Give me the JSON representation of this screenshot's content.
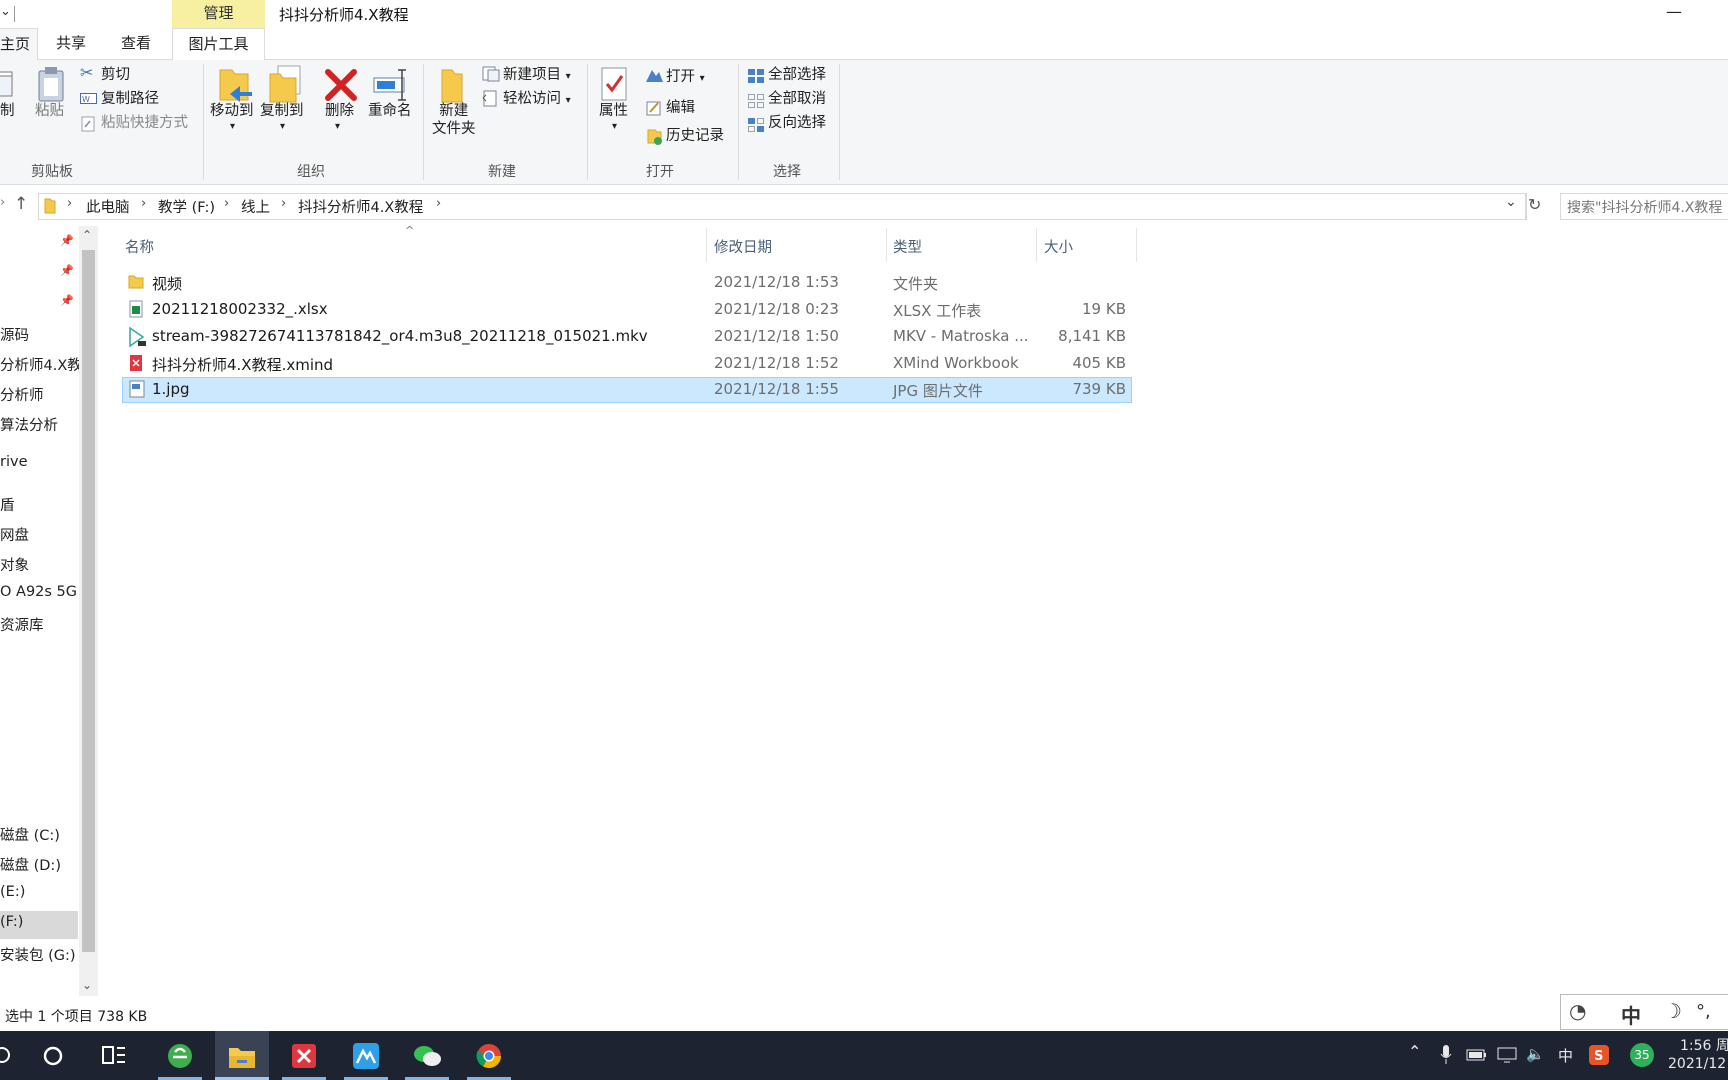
{
  "window": {
    "title": "抖抖分析师4.X教程",
    "context_tab": "管理",
    "minimize": "—"
  },
  "tabs": {
    "home": "主页",
    "share": "共享",
    "view": "查看",
    "picture_tools": "图片工具"
  },
  "ribbon": {
    "clipboard": {
      "label": "剪贴板",
      "copy": "制",
      "paste": "粘贴",
      "cut": "剪切",
      "copy_path": "复制路径",
      "paste_shortcut": "粘贴快捷方式"
    },
    "organize": {
      "label": "组织",
      "move_to": "移动到",
      "copy_to": "复制到",
      "delete": "删除",
      "rename": "重命名"
    },
    "new": {
      "label": "新建",
      "new_folder_line1": "新建",
      "new_folder_line2": "文件夹",
      "new_item": "新建项目",
      "easy_access": "轻松访问"
    },
    "open": {
      "label": "打开",
      "properties": "属性",
      "open": "打开",
      "edit": "编辑",
      "history": "历史记录"
    },
    "select": {
      "label": "选择",
      "select_all": "全部选择",
      "select_none": "全部取消",
      "invert": "反向选择"
    }
  },
  "address": {
    "crumbs": [
      "此电脑",
      "教学 (F:)",
      "线上",
      "抖抖分析师4.X教程"
    ],
    "search_placeholder": "搜索\"抖抖分析师4.X教程"
  },
  "nav": {
    "items": [
      "源码",
      "分析师4.X教",
      "分析师",
      "算法分析",
      "rive",
      "盾",
      "网盘",
      "对象",
      "O A92s 5G",
      "资源库",
      "磁盘 (C:)",
      "磁盘 (D:)",
      "(E:)",
      "(F:)",
      "安装包 (G:)"
    ]
  },
  "columns": {
    "name": "名称",
    "modified": "修改日期",
    "type": "类型",
    "size": "大小"
  },
  "files": [
    {
      "name": "视频",
      "modified": "2021/12/18 1:53",
      "type": "文件夹",
      "size": "",
      "icon": "folder-icon"
    },
    {
      "name": "20211218002332_.xlsx",
      "modified": "2021/12/18 0:23",
      "type": "XLSX 工作表",
      "size": "19 KB",
      "icon": "excel-file-icon"
    },
    {
      "name": "stream-398272674113781842_or4.m3u8_20211218_015021.mkv",
      "modified": "2021/12/18 1:50",
      "type": "MKV - Matroska ...",
      "size": "8,141 KB",
      "icon": "video-file-icon"
    },
    {
      "name": "抖抖分析师4.X教程.xmind",
      "modified": "2021/12/18 1:52",
      "type": "XMind Workbook",
      "size": "405 KB",
      "icon": "xmind-file-icon"
    },
    {
      "name": "1.jpg",
      "modified": "2021/12/18 1:55",
      "type": "JPG 图片文件",
      "size": "739 KB",
      "icon": "image-file-icon"
    }
  ],
  "status": {
    "text": "选中 1 个项目  738 KB"
  },
  "ime": {
    "mode": "中"
  },
  "tray": {
    "input_lang": "中",
    "badge": "35",
    "time": "1:56 周",
    "date": "2021/12"
  }
}
